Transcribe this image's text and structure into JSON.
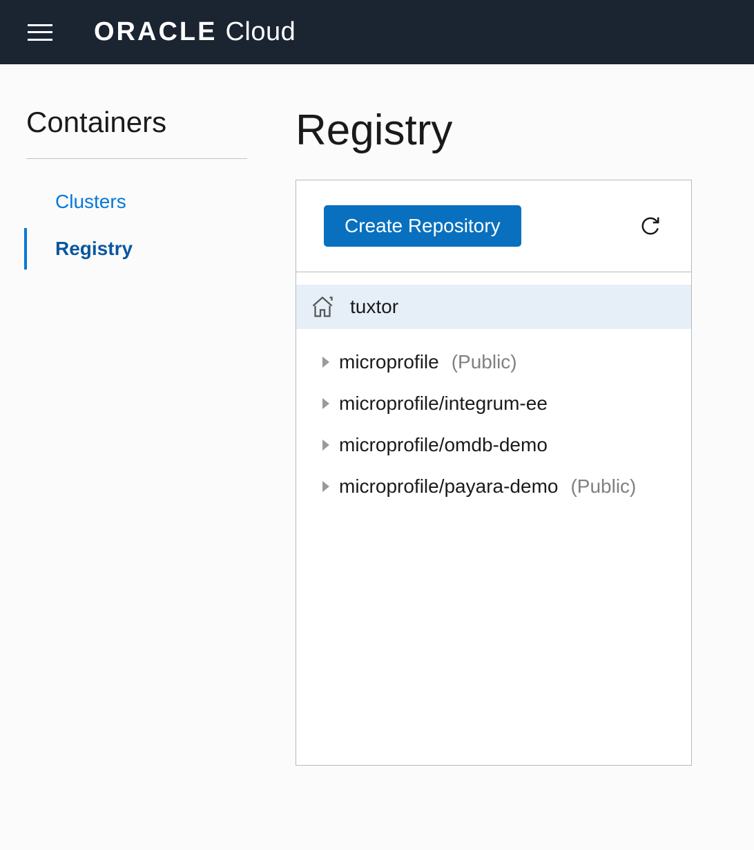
{
  "header": {
    "brand_bold": "ORACLE",
    "brand_light": "Cloud"
  },
  "sidebar": {
    "title": "Containers",
    "items": [
      {
        "label": "Clusters",
        "active": false
      },
      {
        "label": "Registry",
        "active": true
      }
    ]
  },
  "page": {
    "title": "Registry"
  },
  "panel": {
    "create_button_label": "Create Repository",
    "namespace": "tuxtor",
    "repositories": [
      {
        "name": "microprofile",
        "visibility": "(Public)"
      },
      {
        "name": "microprofile/integrum-ee",
        "visibility": ""
      },
      {
        "name": "microprofile/omdb-demo",
        "visibility": ""
      },
      {
        "name": "microprofile/payara-demo",
        "visibility": "(Public)"
      }
    ]
  }
}
